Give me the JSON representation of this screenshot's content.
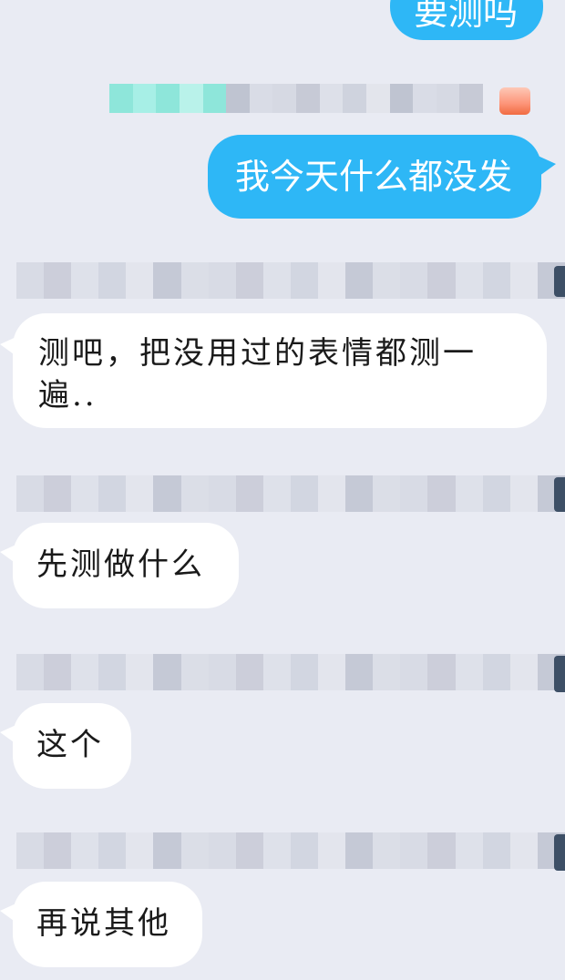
{
  "messages": [
    {
      "sender": "me",
      "text": "要测吗"
    },
    {
      "sender": "me",
      "text": "我今天什么都没发"
    },
    {
      "sender": "other",
      "text": "测吧，把没用过的表情都测一遍.."
    },
    {
      "sender": "other",
      "text": "先测做什么"
    },
    {
      "sender": "other",
      "text": "这个"
    },
    {
      "sender": "other",
      "text": "再说其他"
    }
  ],
  "icons": {
    "sender_badge": "fire-icon"
  },
  "colors": {
    "background": "#e9ebf3",
    "my_bubble": "#2eb7f6",
    "other_bubble": "#ffffff"
  }
}
